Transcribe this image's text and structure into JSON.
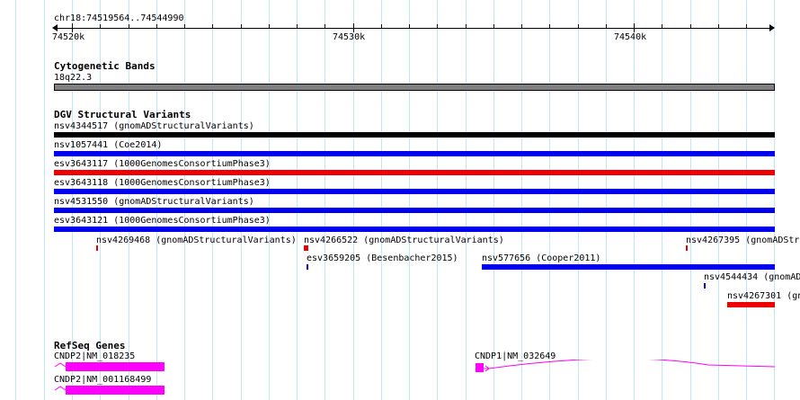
{
  "ruler": {
    "location": "chr18:74519564..74544990",
    "tick_labels": [
      "74520k",
      "74530k",
      "74540k"
    ]
  },
  "cytoband": {
    "title": "Cytogenetic Bands",
    "band": "18q22.3",
    "color": "#808080"
  },
  "dgv": {
    "title": "DGV Structural Variants",
    "variants": [
      {
        "label": "nsv4344517 (gnomADStructuralVariants)",
        "color": "#000000"
      },
      {
        "label": "nsv1057441 (Coe2014)",
        "color": "#0000ee"
      },
      {
        "label": "esv3643117 (1000GenomesConsortiumPhase3)",
        "color": "#ee0000"
      },
      {
        "label": "esv3643118 (1000GenomesConsortiumPhase3)",
        "color": "#0000ee"
      },
      {
        "label": "nsv4531550 (gnomADStructuralVariants)",
        "color": "#0000ee"
      },
      {
        "label": "esv3643121 (1000GenomesConsortiumPhase3)",
        "color": "#0000ee"
      },
      {
        "label": "nsv4269468 (gnomADStructuralVariants)",
        "color": "#ee0000"
      },
      {
        "label": "nsv4266522 (gnomADStructuralVariants)",
        "color": "#ee0000"
      },
      {
        "label": "nsv4267395 (gnomADStr",
        "color": "#ee0000"
      },
      {
        "label": "esv3659205 (Besenbacher2015)",
        "color": "#0000ee"
      },
      {
        "label": "nsv577656 (Cooper2011)",
        "color": "#0000ee"
      },
      {
        "label": "nsv4544434 (gnomAD",
        "color": "#0000ee"
      },
      {
        "label": "nsv4267301 (gn",
        "color": "#ee0000"
      }
    ]
  },
  "refseq": {
    "title": "RefSeq Genes",
    "color": "#ff00ff",
    "genes": [
      {
        "label": "CNDP2|NM_018235"
      },
      {
        "label": "CNDP2|NM_001168499"
      },
      {
        "label": "CNDP1|NM_032649"
      }
    ]
  }
}
